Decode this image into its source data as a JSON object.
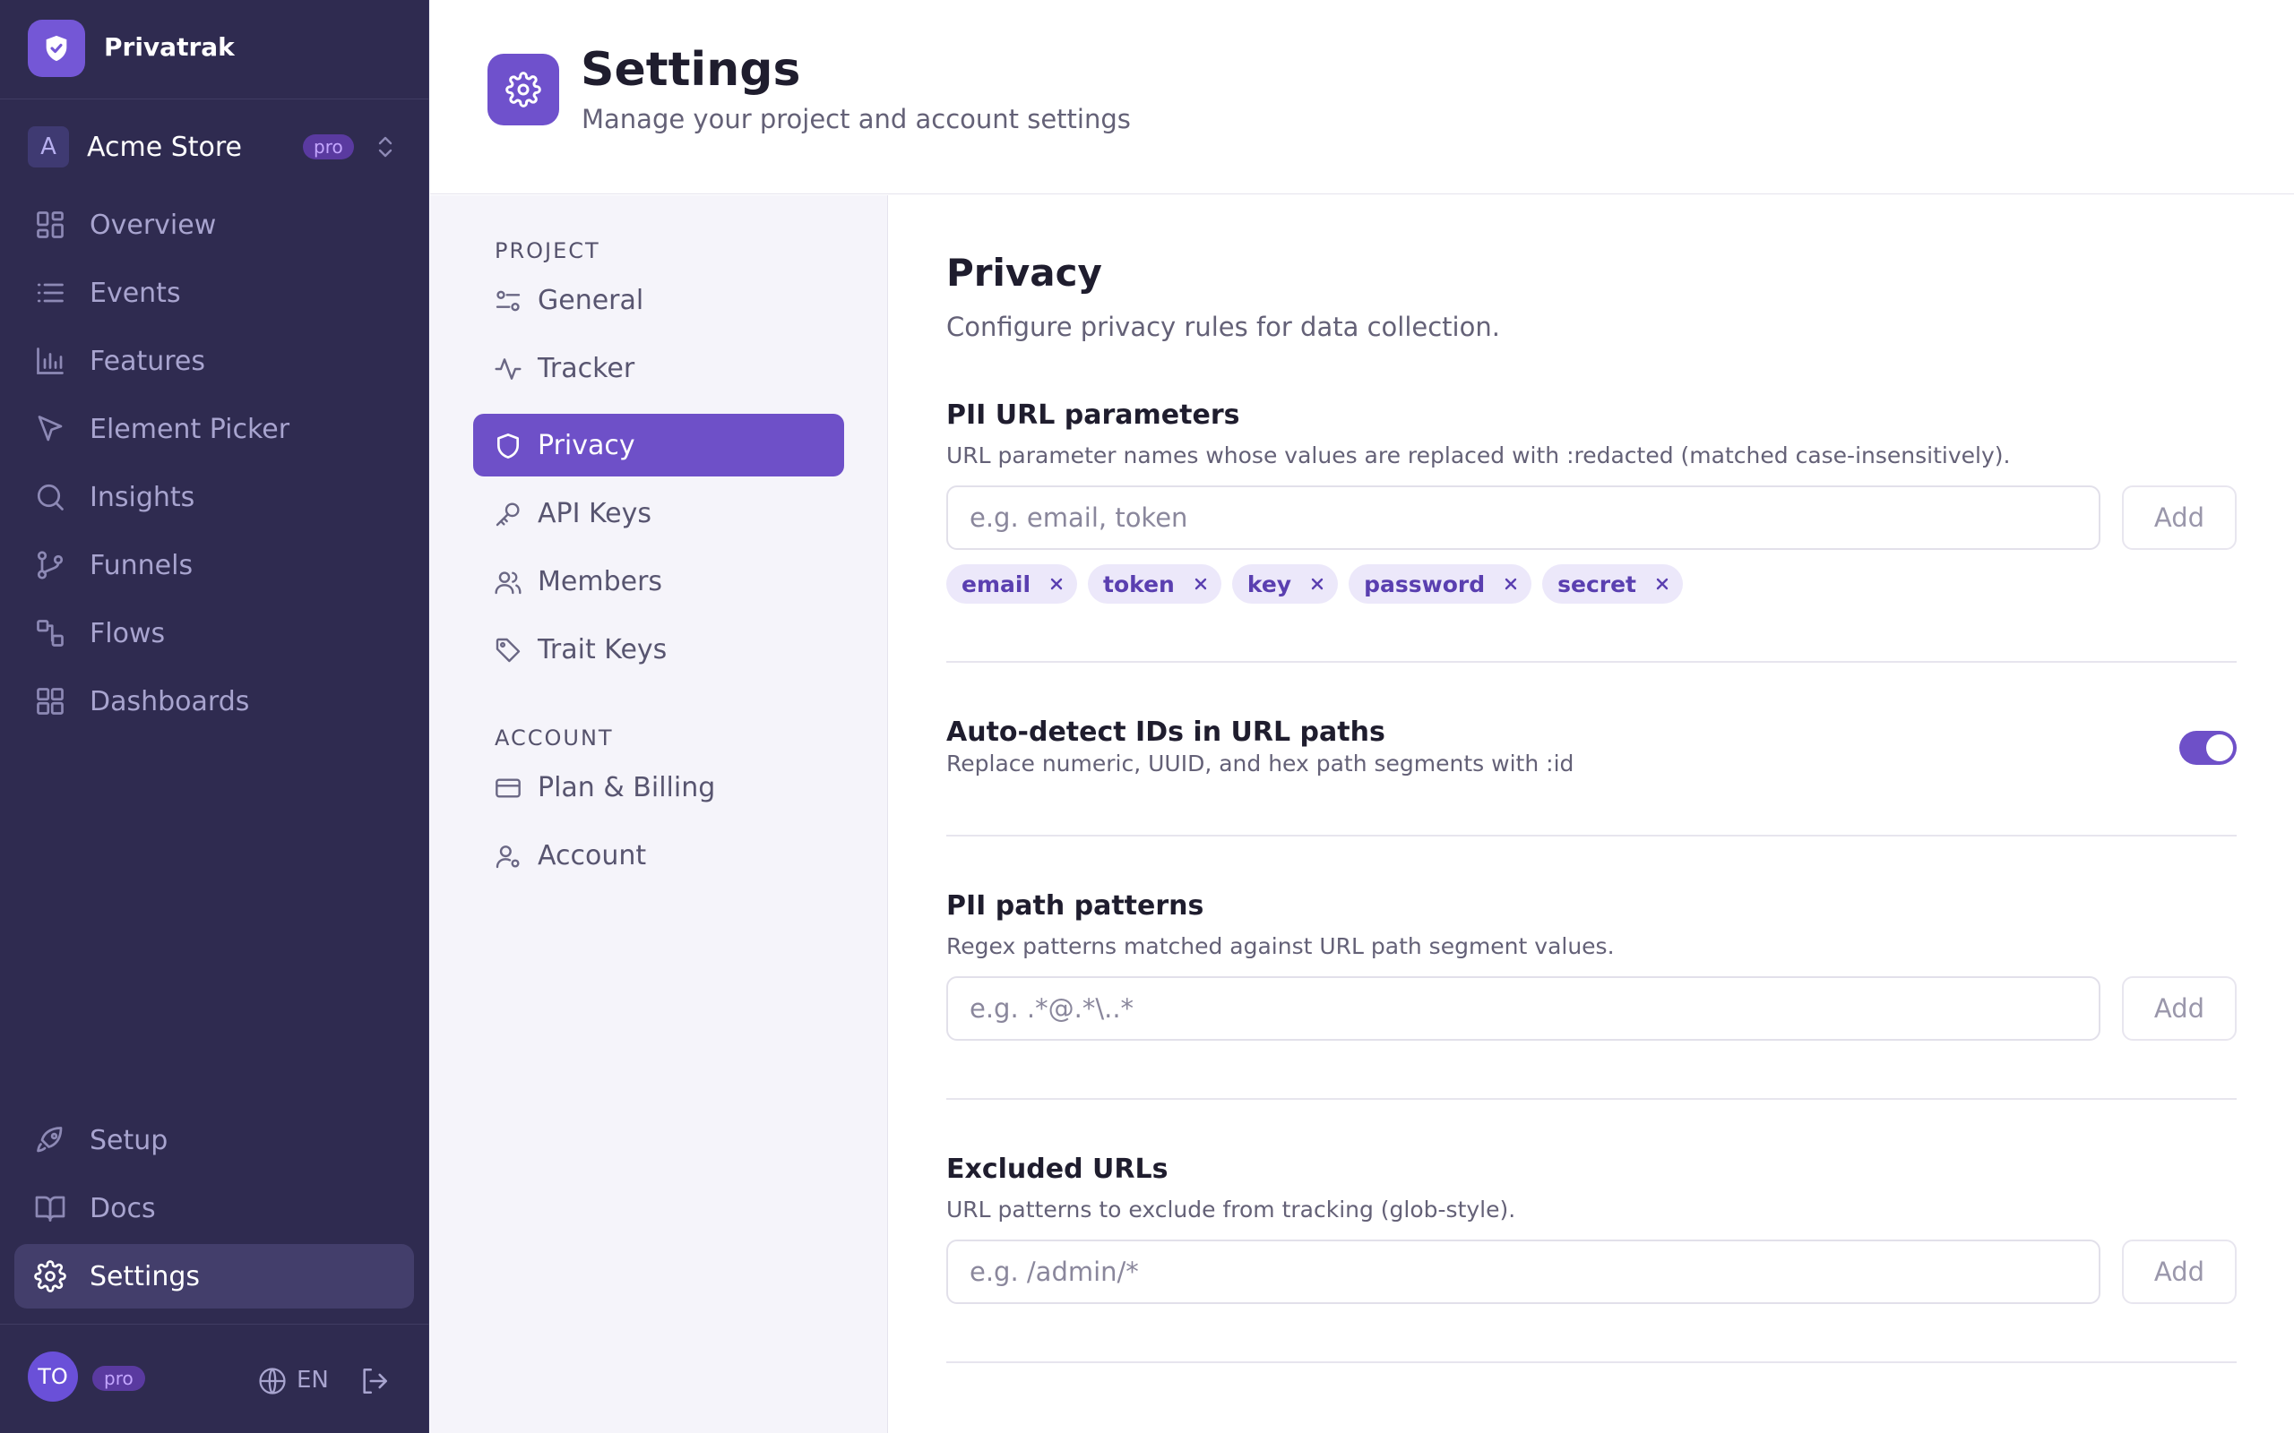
{
  "brand": {
    "name": "Privatrak"
  },
  "project": {
    "avatar_letter": "A",
    "name": "Acme Store",
    "badge": "pro"
  },
  "sidebar": {
    "items": [
      {
        "label": "Overview",
        "icon": "grid-icon"
      },
      {
        "label": "Events",
        "icon": "list-icon"
      },
      {
        "label": "Features",
        "icon": "bar-chart-icon"
      },
      {
        "label": "Element Picker",
        "icon": "cursor-icon"
      },
      {
        "label": "Insights",
        "icon": "search-icon"
      },
      {
        "label": "Funnels",
        "icon": "branch-icon"
      },
      {
        "label": "Flows",
        "icon": "flow-icon"
      },
      {
        "label": "Dashboards",
        "icon": "dashboard-icon"
      }
    ],
    "bottom_items": [
      {
        "label": "Setup",
        "icon": "rocket-icon"
      },
      {
        "label": "Docs",
        "icon": "book-icon"
      },
      {
        "label": "Settings",
        "icon": "gear-icon",
        "active": true
      }
    ]
  },
  "user": {
    "initials": "TO",
    "badge": "pro",
    "language": "EN"
  },
  "header": {
    "title": "Settings",
    "subtitle": "Manage your project and account settings"
  },
  "subnav": {
    "project_heading": "PROJECT",
    "project_items": [
      {
        "label": "General",
        "icon": "sliders-icon"
      },
      {
        "label": "Tracker",
        "icon": "activity-icon"
      },
      {
        "label": "Privacy",
        "icon": "shield-icon",
        "active": true
      },
      {
        "label": "API Keys",
        "icon": "key-icon"
      },
      {
        "label": "Members",
        "icon": "users-icon"
      },
      {
        "label": "Trait Keys",
        "icon": "tag-icon"
      }
    ],
    "account_heading": "ACCOUNT",
    "account_items": [
      {
        "label": "Plan & Billing",
        "icon": "credit-card-icon"
      },
      {
        "label": "Account",
        "icon": "user-gear-icon"
      }
    ]
  },
  "privacy": {
    "title": "Privacy",
    "description": "Configure privacy rules for data collection.",
    "pii_url_params": {
      "title": "PII URL parameters",
      "description": "URL parameter names whose values are replaced with :redacted (matched case-insensitively).",
      "placeholder": "e.g. email, token",
      "add_label": "Add",
      "chips": [
        "email",
        "token",
        "key",
        "password",
        "secret"
      ]
    },
    "auto_detect": {
      "title": "Auto-detect IDs in URL paths",
      "description": "Replace numeric, UUID, and hex path segments with :id",
      "enabled": true
    },
    "pii_path_patterns": {
      "title": "PII path patterns",
      "description": "Regex patterns matched against URL path segment values.",
      "placeholder": "e.g. .*@.*\\..*",
      "add_label": "Add"
    },
    "excluded_urls": {
      "title": "Excluded URLs",
      "description": "URL patterns to exclude from tracking (glob-style).",
      "placeholder": "e.g. /admin/*",
      "add_label": "Add"
    }
  },
  "colors": {
    "sidebar_bg": "#2f2b50",
    "accent": "#6e50c8",
    "chip_bg": "#ece8fa",
    "chip_text": "#5a3fb0"
  }
}
